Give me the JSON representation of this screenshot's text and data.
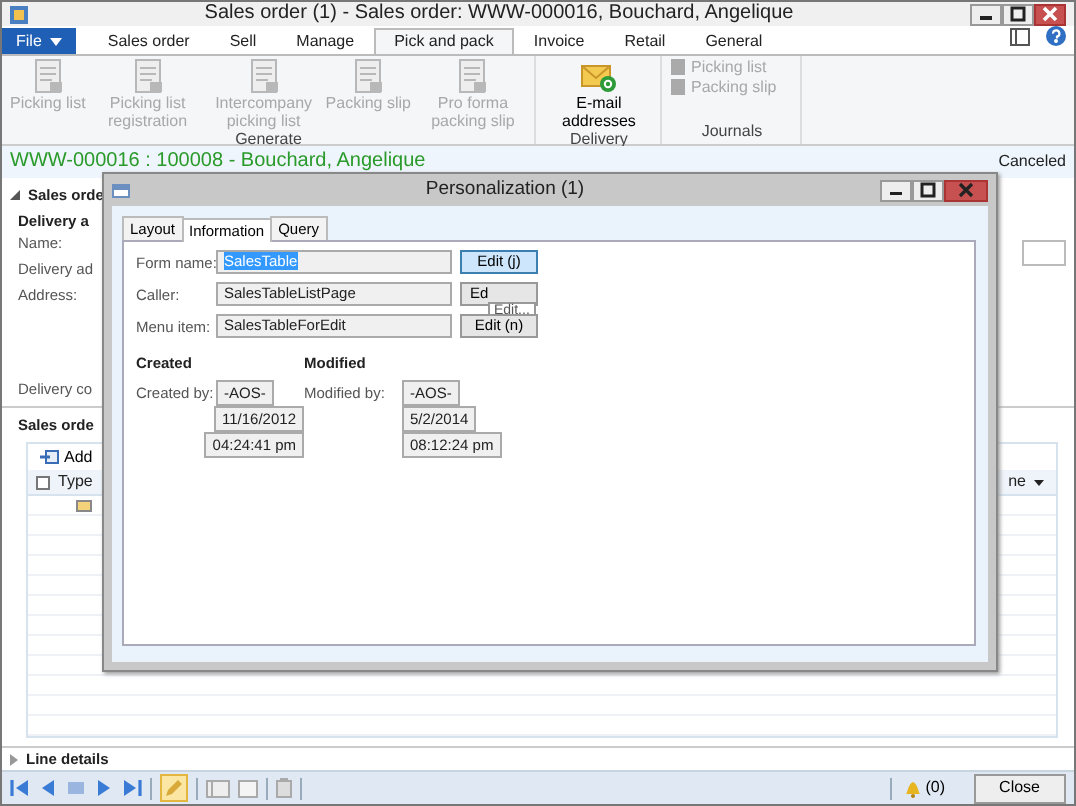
{
  "window": {
    "title": "Sales order (1) - Sales order: WWW-000016, Bouchard, Angelique"
  },
  "ribbon": {
    "tabs": [
      {
        "label": "File",
        "kind": "file",
        "selected": false
      },
      {
        "label": "Sales order",
        "kind": "tab",
        "selected": false
      },
      {
        "label": "Sell",
        "kind": "tab",
        "selected": false
      },
      {
        "label": "Manage",
        "kind": "tab",
        "selected": false
      },
      {
        "label": "Pick and pack",
        "kind": "tab",
        "selected": true
      },
      {
        "label": "Invoice",
        "kind": "tab",
        "selected": false
      },
      {
        "label": "Retail",
        "kind": "tab",
        "selected": false
      },
      {
        "label": "General",
        "kind": "tab",
        "selected": false
      }
    ],
    "groups": [
      {
        "label": "Generate",
        "kind": "large",
        "buttons": [
          {
            "label": "Picking list",
            "disabled": true
          },
          {
            "label": "Picking list registration",
            "disabled": true
          },
          {
            "label": "Intercompany picking list",
            "disabled": true
          },
          {
            "label": "Packing slip",
            "disabled": true
          },
          {
            "label": "Pro forma packing slip",
            "disabled": true
          }
        ]
      },
      {
        "label": "Delivery",
        "kind": "large",
        "buttons": [
          {
            "label": "E-mail addresses",
            "disabled": false
          }
        ]
      },
      {
        "label": "Journals",
        "kind": "small",
        "buttons": [
          {
            "label": "Picking list",
            "disabled": true
          },
          {
            "label": "Packing slip",
            "disabled": true
          }
        ]
      }
    ]
  },
  "header": {
    "title": "WWW-000016 : 100008 - Bouchard, Angelique",
    "status": "Canceled"
  },
  "form": {
    "section": "Sales orde",
    "group": "Delivery a",
    "labels": [
      "Name:",
      "Delivery ad",
      "Address:"
    ],
    "last_label": "Delivery co"
  },
  "lines": {
    "section": "Sales orde",
    "add": "Add",
    "select_all_checked": false,
    "column_1": "Type",
    "column_right": "ne"
  },
  "line_details": "Line details",
  "dialog": {
    "title": "Personalization (1)",
    "tabs": [
      {
        "label": "Layout",
        "selected": false
      },
      {
        "label": "Information",
        "selected": true
      },
      {
        "label": "Query",
        "selected": false
      }
    ],
    "fields": [
      {
        "label": "Form name:",
        "value": "SalesTable",
        "value_selected": true,
        "button": "Edit (j)",
        "button_focused": true
      },
      {
        "label": "Caller:",
        "value": "SalesTableListPage",
        "value_selected": false,
        "button": "Ed",
        "button_focused": false
      },
      {
        "label": "Menu item:",
        "value": "SalesTableForEdit",
        "value_selected": false,
        "button": "Edit (n)",
        "button_focused": false
      }
    ],
    "tooltip": "Edit...",
    "created": {
      "heading": "Created",
      "label": "Created by:",
      "values": [
        "-AOS-",
        "11/16/2012",
        "04:24:41 pm"
      ]
    },
    "modified": {
      "heading": "Modified",
      "label": "Modified by:",
      "values": [
        "-AOS-",
        "5/2/2014",
        "08:12:24 pm"
      ]
    }
  },
  "status_bar": {
    "edit_mode": true,
    "notifications": "(0)",
    "close": "Close"
  }
}
